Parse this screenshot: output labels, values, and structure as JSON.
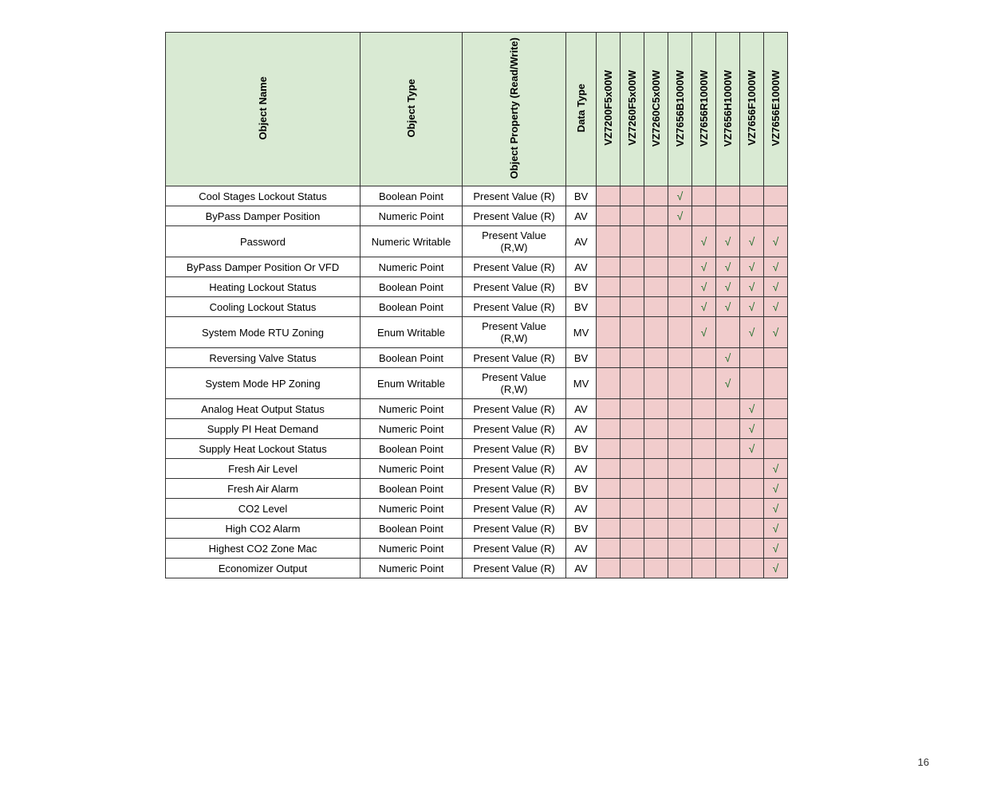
{
  "page_number": "16",
  "headers": {
    "name": "Object Name",
    "type": "Object Type",
    "prop": "Object Property (Read/Write)",
    "data": "Data Type",
    "models": [
      "VZ7200F5x00W",
      "VZ7260F5x00W",
      "VZ7260C5x00W",
      "VZ7656B1000W",
      "VZ7656R1000W",
      "VZ7656H1000W",
      "VZ7656F1000W",
      "VZ7656E1000W"
    ]
  },
  "tick_char": "√",
  "chart_data": {
    "type": "table",
    "columns": [
      "Object Name",
      "Object Type",
      "Object Property (Read/Write)",
      "Data Type",
      "VZ7200F5x00W",
      "VZ7260F5x00W",
      "VZ7260C5x00W",
      "VZ7656B1000W",
      "VZ7656R1000W",
      "VZ7656H1000W",
      "VZ7656F1000W",
      "VZ7656E1000W"
    ],
    "rows": [
      {
        "name": "Cool Stages Lockout Status",
        "type": "Boolean Point",
        "prop": "Present Value (R)",
        "data": "BV",
        "marks": [
          0,
          0,
          0,
          1,
          0,
          0,
          0,
          0
        ]
      },
      {
        "name": "ByPass Damper Position",
        "type": "Numeric Point",
        "prop": "Present Value (R)",
        "data": "AV",
        "marks": [
          0,
          0,
          0,
          1,
          0,
          0,
          0,
          0
        ]
      },
      {
        "name": "Password",
        "type": "Numeric Writable",
        "prop": "Present Value (R,W)",
        "data": "AV",
        "marks": [
          0,
          0,
          0,
          0,
          1,
          1,
          1,
          1
        ]
      },
      {
        "name": "ByPass Damper Position Or VFD",
        "type": "Numeric Point",
        "prop": "Present Value (R)",
        "data": "AV",
        "marks": [
          0,
          0,
          0,
          0,
          1,
          1,
          1,
          1
        ]
      },
      {
        "name": "Heating Lockout Status",
        "type": "Boolean Point",
        "prop": "Present Value (R)",
        "data": "BV",
        "marks": [
          0,
          0,
          0,
          0,
          1,
          1,
          1,
          1
        ]
      },
      {
        "name": "Cooling Lockout Status",
        "type": "Boolean Point",
        "prop": "Present Value (R)",
        "data": "BV",
        "marks": [
          0,
          0,
          0,
          0,
          1,
          1,
          1,
          1
        ]
      },
      {
        "name": "System Mode RTU Zoning",
        "type": "Enum Writable",
        "prop": "Present Value (R,W)",
        "data": "MV",
        "marks": [
          0,
          0,
          0,
          0,
          1,
          0,
          1,
          1
        ]
      },
      {
        "name": "Reversing Valve Status",
        "type": "Boolean Point",
        "prop": "Present Value (R)",
        "data": "BV",
        "marks": [
          0,
          0,
          0,
          0,
          0,
          1,
          0,
          0
        ]
      },
      {
        "name": "System Mode HP Zoning",
        "type": "Enum Writable",
        "prop": "Present Value (R,W)",
        "data": "MV",
        "marks": [
          0,
          0,
          0,
          0,
          0,
          1,
          0,
          0
        ]
      },
      {
        "name": "Analog Heat Output Status",
        "type": "Numeric Point",
        "prop": "Present Value (R)",
        "data": "AV",
        "marks": [
          0,
          0,
          0,
          0,
          0,
          0,
          1,
          0
        ]
      },
      {
        "name": "Supply PI Heat Demand",
        "type": "Numeric Point",
        "prop": "Present Value (R)",
        "data": "AV",
        "marks": [
          0,
          0,
          0,
          0,
          0,
          0,
          1,
          0
        ]
      },
      {
        "name": "Supply Heat Lockout Status",
        "type": "Boolean Point",
        "prop": "Present Value (R)",
        "data": "BV",
        "marks": [
          0,
          0,
          0,
          0,
          0,
          0,
          1,
          0
        ]
      },
      {
        "name": "Fresh Air Level",
        "type": "Numeric Point",
        "prop": "Present Value (R)",
        "data": "AV",
        "marks": [
          0,
          0,
          0,
          0,
          0,
          0,
          0,
          1
        ]
      },
      {
        "name": "Fresh Air Alarm",
        "type": "Boolean Point",
        "prop": "Present Value (R)",
        "data": "BV",
        "marks": [
          0,
          0,
          0,
          0,
          0,
          0,
          0,
          1
        ]
      },
      {
        "name": "CO2 Level",
        "type": "Numeric Point",
        "prop": "Present Value (R)",
        "data": "AV",
        "marks": [
          0,
          0,
          0,
          0,
          0,
          0,
          0,
          1
        ]
      },
      {
        "name": "High CO2 Alarm",
        "type": "Boolean Point",
        "prop": "Present Value (R)",
        "data": "BV",
        "marks": [
          0,
          0,
          0,
          0,
          0,
          0,
          0,
          1
        ]
      },
      {
        "name": "Highest CO2 Zone Mac",
        "type": "Numeric Point",
        "prop": "Present Value (R)",
        "data": "AV",
        "marks": [
          0,
          0,
          0,
          0,
          0,
          0,
          0,
          1
        ]
      },
      {
        "name": "Economizer Output",
        "type": "Numeric Point",
        "prop": "Present Value (R)",
        "data": "AV",
        "marks": [
          0,
          0,
          0,
          0,
          0,
          0,
          0,
          1
        ]
      }
    ]
  }
}
